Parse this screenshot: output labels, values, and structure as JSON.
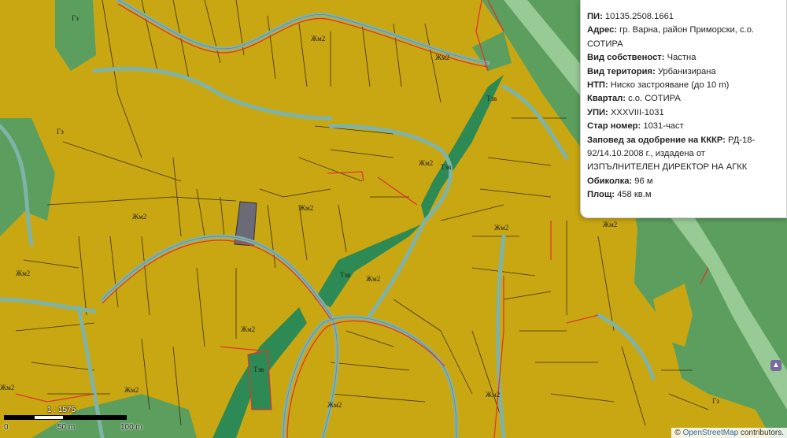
{
  "popup": {
    "rows": [
      {
        "label": "ПИ:",
        "value": "10135.2508.1661"
      },
      {
        "label": "Адрес:",
        "value": "гр. Варна, район Приморски, с.о. СОТИРА"
      },
      {
        "label": "Вид собственост:",
        "value": "Частна"
      },
      {
        "label": "Вид територия:",
        "value": "Урбанизирана"
      },
      {
        "label": "НТП:",
        "value": "Ниско застрояване (до 10 m)"
      },
      {
        "label": "Квартал:",
        "value": "с.о. СОТИРА"
      },
      {
        "label": "УПИ:",
        "value": "XXXVIII-1031"
      },
      {
        "label": "Стар номер:",
        "value": "1031-част"
      },
      {
        "label": "Заповед за одобрение на КККР:",
        "value": "РД-18-92/14.10.2008 г., издадена от ИЗПЪЛНИТЕЛЕН ДИРЕКТОР НА АГКК"
      },
      {
        "label": "Обиколка:",
        "value": "96 м"
      },
      {
        "label": "Площ:",
        "value": "458 кв.м"
      }
    ]
  },
  "map_labels": {
    "zhm2": "Жм2",
    "tzv": "Тзв",
    "gz": "Гз"
  },
  "scale": {
    "ratio": "1 : 1575",
    "tick0": "0",
    "tick50": "50 m",
    "tick100": "100 m"
  },
  "attribution": {
    "symbol": "©",
    "link": "OpenStreetMap",
    "suffix": "contributors."
  },
  "colors": {
    "parcel": "#c9a712",
    "forest": "#5c9e5e",
    "dark_green": "#2e8a55",
    "road": "#7fb3a8",
    "red_line": "#e0362a",
    "selected": "#6b6b78"
  }
}
